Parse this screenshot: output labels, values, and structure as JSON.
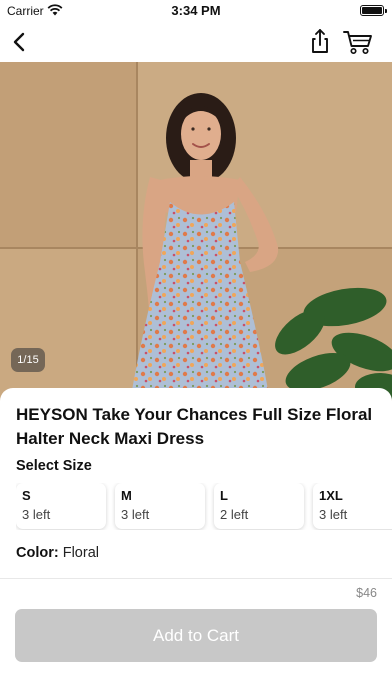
{
  "status_bar": {
    "carrier": "Carrier",
    "time": "3:34 PM"
  },
  "nav": {
    "back_icon": "chevron-left-icon",
    "share_icon": "share-icon",
    "cart_icon": "cart-icon"
  },
  "gallery": {
    "counter": "1/15"
  },
  "product": {
    "title": "HEYSON Take Your Chances Full Size Floral Halter Neck Maxi Dress",
    "select_size_label": "Select Size",
    "sizes": [
      {
        "name": "S",
        "stock": "3 left"
      },
      {
        "name": "M",
        "stock": "3 left"
      },
      {
        "name": "L",
        "stock": "2 left"
      },
      {
        "name": "1XL",
        "stock": "3 left"
      }
    ],
    "color_label": "Color:",
    "color_value": "Floral"
  },
  "purchase": {
    "price": "$46",
    "add_to_cart_label": "Add to Cart"
  },
  "colors": {
    "button_disabled": "#c8c8c8",
    "background": "#ffffff",
    "wall": "#c7a780"
  }
}
